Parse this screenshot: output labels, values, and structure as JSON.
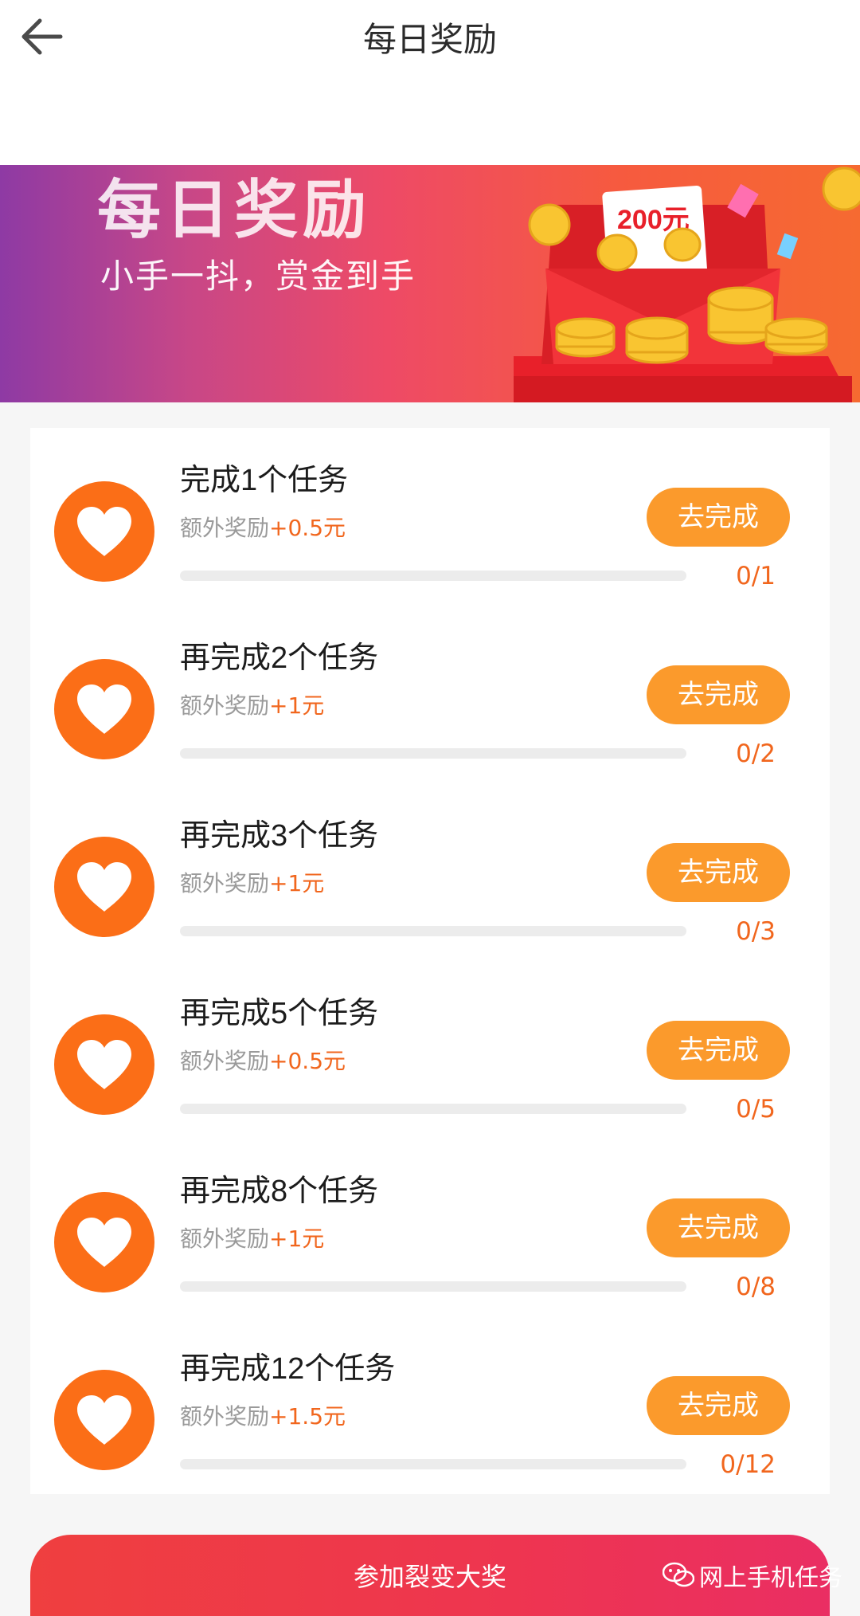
{
  "header": {
    "title": "每日奖励",
    "back_icon": "arrow-left-icon"
  },
  "banner": {
    "title": "每日奖励",
    "subtitle": "小手一抖，赏金到手",
    "art_note": "200元"
  },
  "tasks": [
    {
      "title": "完成1个任务",
      "reward_label": "额外奖励",
      "reward_value": "+0.5元",
      "button": "去完成",
      "progress": "0/1",
      "progress_fraction": 0
    },
    {
      "title": "再完成2个任务",
      "reward_label": "额外奖励",
      "reward_value": "+1元",
      "button": "去完成",
      "progress": "0/2",
      "progress_fraction": 0
    },
    {
      "title": "再完成3个任务",
      "reward_label": "额外奖励",
      "reward_value": "+1元",
      "button": "去完成",
      "progress": "0/3",
      "progress_fraction": 0
    },
    {
      "title": "再完成5个任务",
      "reward_label": "额外奖励",
      "reward_value": "+0.5元",
      "button": "去完成",
      "progress": "0/5",
      "progress_fraction": 0
    },
    {
      "title": "再完成8个任务",
      "reward_label": "额外奖励",
      "reward_value": "+1元",
      "button": "去完成",
      "progress": "0/8",
      "progress_fraction": 0
    },
    {
      "title": "再完成12个任务",
      "reward_label": "额外奖励",
      "reward_value": "+1.5元",
      "button": "去完成",
      "progress": "0/12",
      "progress_fraction": 0
    }
  ],
  "cta": {
    "label": "参加裂变大奖"
  },
  "watermark": {
    "text": "网上手机任务",
    "icon": "wechat-icon"
  },
  "colors": {
    "accent_orange": "#fb9a2c",
    "icon_orange": "#fb6e17",
    "reward_orange": "#f1661d",
    "cta_red": "#ee3550"
  }
}
